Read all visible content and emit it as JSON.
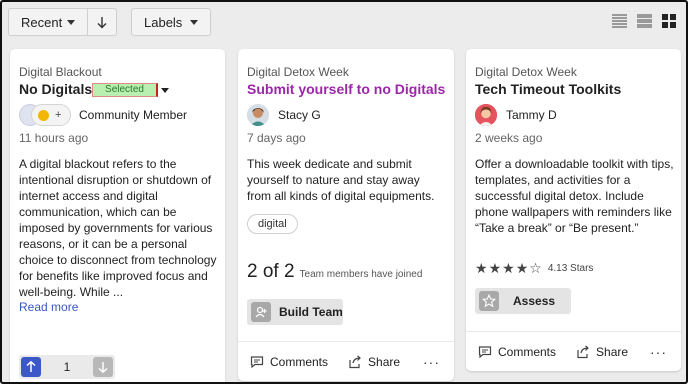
{
  "toolbar": {
    "sort_label": "Recent",
    "labels_label": "Labels"
  },
  "cards": [
    {
      "category": "Digital Blackout",
      "title": "No Digitals",
      "badge": "Selected",
      "author": "Community Member",
      "time": "11 hours ago",
      "description": "A digital blackout refers to the intentional disruption or shutdown of internet access and digital communication, which can be imposed by governments for various reasons, or it can be a personal choice to disconnect from technology for benefits like improved focus and well-being. While ...",
      "read_more": "Read more",
      "vote_count": "1",
      "avatar_extra": "+"
    },
    {
      "category": "Digital Detox Week",
      "title": "Submit yourself to no Digitals",
      "author": "Stacy G",
      "time": "7 days ago",
      "description": "This week dedicate and submit yourself to nature and stay away from all kinds of digital equipments.",
      "tag": "digital",
      "team_count": "2 of 2",
      "team_text": "Team members have joined",
      "action": "Build Team",
      "comments": "Comments",
      "share": "Share",
      "more": "···"
    },
    {
      "category": "Digital Detox Week",
      "title": "Tech Timeout Toolkits",
      "author": "Tammy D",
      "time": "2 weeks ago",
      "description": "Offer a downloadable toolkit with tips, templates, and activities for a successful digital detox. Include phone wallpapers with reminders like “Take a break” or “Be present.”",
      "rating": 4.13,
      "rating_text": "4.13 Stars",
      "action": "Assess",
      "comments": "Comments",
      "share": "Share",
      "more": "···"
    }
  ],
  "colors": {
    "accent_blue": "#3b57c8",
    "title_purple": "#9b27a8",
    "link_blue": "#3b55c4"
  }
}
